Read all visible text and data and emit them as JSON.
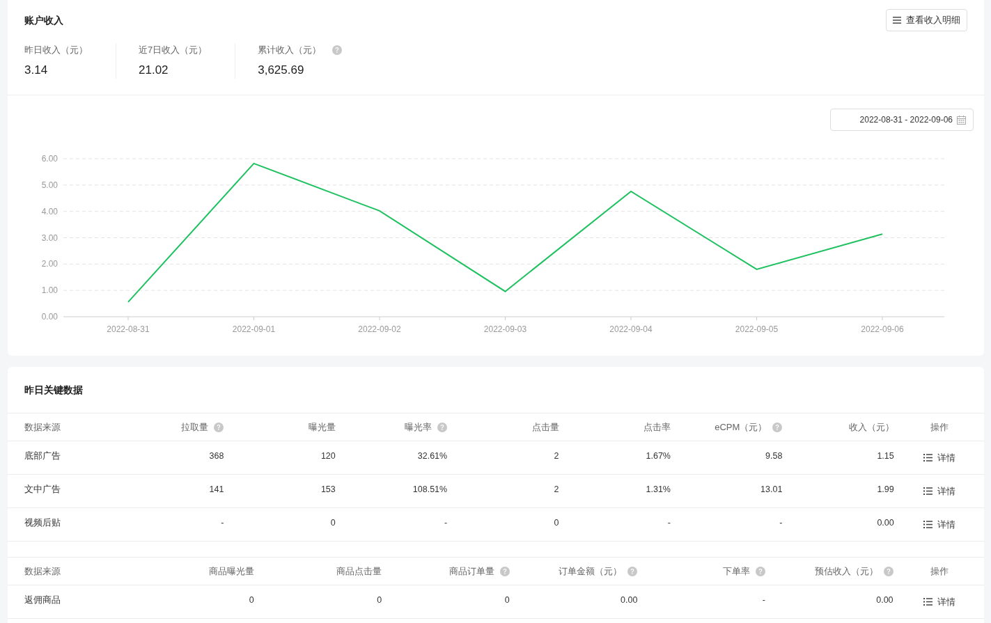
{
  "income": {
    "title": "账户收入",
    "detail_button": "查看收入明细",
    "stats": [
      {
        "label": "昨日收入（元）",
        "value": "3.14",
        "help": false
      },
      {
        "label": "近7日收入（元）",
        "value": "21.02",
        "help": false
      },
      {
        "label": "累计收入（元）",
        "value": "3,625.69",
        "help": true
      }
    ],
    "date_range": "2022-08-31 - 2022-09-06",
    "chart_data": {
      "type": "line",
      "categories": [
        "2022-08-31",
        "2022-09-01",
        "2022-09-02",
        "2022-09-03",
        "2022-09-04",
        "2022-09-05",
        "2022-09-06"
      ],
      "grid": true,
      "series": [
        {
          "color": "#1ec15f",
          "values": [
            0.56,
            5.82,
            4.02,
            0.96,
            4.76,
            1.8,
            3.14
          ]
        }
      ],
      "ylim": [
        0,
        6
      ],
      "yticks": [
        {
          "value": 0,
          "label": "0.00"
        },
        {
          "value": 1,
          "label": "1.00"
        },
        {
          "value": 2,
          "label": "2.00"
        },
        {
          "value": 3,
          "label": "3.00"
        },
        {
          "value": 4,
          "label": "4.00"
        },
        {
          "value": 5,
          "label": "5.00"
        },
        {
          "value": 6,
          "label": "6.00"
        }
      ]
    }
  },
  "key_data": {
    "title": "昨日关键数据",
    "tables": [
      {
        "columns": [
          {
            "label": "数据来源",
            "help": false
          },
          {
            "label": "拉取量",
            "help": true
          },
          {
            "label": "曝光量",
            "help": false
          },
          {
            "label": "曝光率",
            "help": true
          },
          {
            "label": "点击量",
            "help": false
          },
          {
            "label": "点击率",
            "help": false
          },
          {
            "label": "eCPM（元）",
            "help": true
          },
          {
            "label": "收入（元）",
            "help": false
          },
          {
            "label": "操作",
            "help": false
          }
        ],
        "rows": [
          {
            "cells": [
              "底部广告",
              "368",
              "120",
              "32.61%",
              "2",
              "1.67%",
              "9.58",
              "1.15"
            ],
            "action": "详情"
          },
          {
            "cells": [
              "文中广告",
              "141",
              "153",
              "108.51%",
              "2",
              "1.31%",
              "13.01",
              "1.99"
            ],
            "action": "详情"
          },
          {
            "cells": [
              "视频后贴",
              "-",
              "0",
              "-",
              "0",
              "-",
              "-",
              "0.00"
            ],
            "action": "详情"
          }
        ]
      },
      {
        "columns": [
          {
            "label": "数据来源",
            "help": false
          },
          {
            "label": "商品曝光量",
            "help": false
          },
          {
            "label": "商品点击量",
            "help": false
          },
          {
            "label": "商品订单量",
            "help": true
          },
          {
            "label": "订单金额（元）",
            "help": true
          },
          {
            "label": "下单率",
            "help": true
          },
          {
            "label": "预估收入（元）",
            "help": true
          },
          {
            "label": "操作",
            "help": false
          }
        ],
        "rows": [
          {
            "cells": [
              "返佣商品",
              "0",
              "0",
              "0",
              "0.00",
              "-",
              "0.00"
            ],
            "action": "详情"
          }
        ]
      }
    ]
  }
}
